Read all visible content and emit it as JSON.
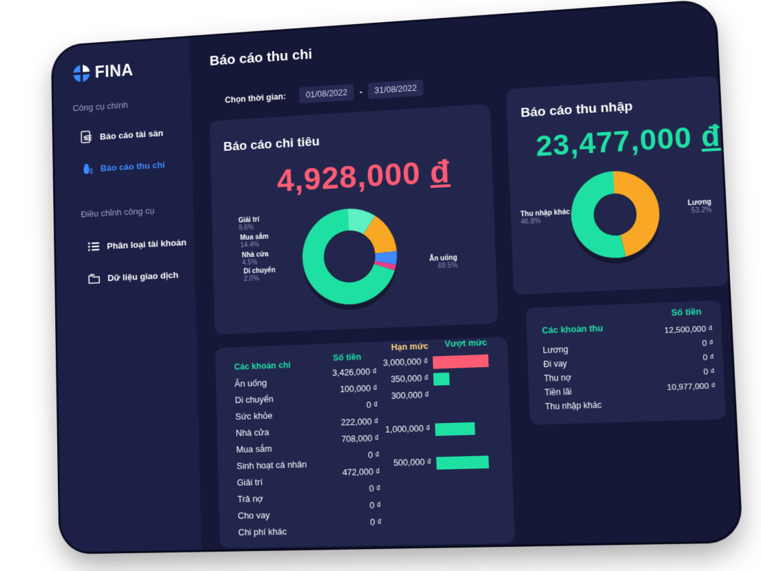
{
  "app": {
    "name": "FINA"
  },
  "sidebar": {
    "heading_main": "Công cụ chính",
    "items_main": [
      {
        "label": "Báo cáo tài sản"
      },
      {
        "label": "Báo cáo thu chi"
      }
    ],
    "heading_tools": "Điều chỉnh công cụ",
    "items_tools": [
      {
        "label": "Phân loại tài khoản"
      },
      {
        "label": "Dữ liệu giao dịch"
      }
    ]
  },
  "header": {
    "title": "Báo cáo thu chi",
    "date_label": "Chọn thời gian:",
    "date_from": "01/08/2022",
    "date_sep": "-",
    "date_to": "31/08/2022"
  },
  "expense": {
    "title": "Báo cáo chi tiêu",
    "total": "4,928,000",
    "currency": "đ",
    "color": "#ff5c74",
    "slices": [
      {
        "name": "Giải trí",
        "pct": "9.6%",
        "value": 9.6,
        "color": "#5eefc3"
      },
      {
        "name": "Mua sắm",
        "pct": "14.4%",
        "value": 14.4,
        "color": "#f9a825"
      },
      {
        "name": "Nhà cửa",
        "pct": "4.5%",
        "value": 4.5,
        "color": "#3d8bff"
      },
      {
        "name": "Di chuyển",
        "pct": "2.0%",
        "value": 2.0,
        "color": "#e83e8c"
      },
      {
        "name": "Ăn uống",
        "pct": "69.5%",
        "value": 69.5,
        "color": "#1fe0a3"
      }
    ],
    "table": {
      "col_category": "Các khoản chi",
      "col_amount": "Số tiền",
      "col_limit": "Hạn mức",
      "col_over": "Vượt mức",
      "rows": [
        {
          "name": "Ăn uống",
          "amount": "3,426,000 ₫",
          "limit": "3,000,000 ₫",
          "bar": 1.0,
          "bar_color": "#ff5c74"
        },
        {
          "name": "Di chuyển",
          "amount": "100,000 ₫",
          "limit": "350,000 ₫",
          "bar": 0.29,
          "bar_color": "#1fe0a3"
        },
        {
          "name": "Sức khỏe",
          "amount": "0 ₫",
          "limit": "300,000 ₫",
          "bar": 0,
          "bar_color": "#1fe0a3"
        },
        {
          "name": "Nhà cửa",
          "amount": "222,000 ₫",
          "limit": "",
          "bar": 0,
          "bar_color": "#1fe0a3"
        },
        {
          "name": "Mua sắm",
          "amount": "708,000 ₫",
          "limit": "1,000,000 ₫",
          "bar": 0.71,
          "bar_color": "#1fe0a3"
        },
        {
          "name": "Sinh hoạt cá nhân",
          "amount": "0 ₫",
          "limit": "",
          "bar": 0,
          "bar_color": "#1fe0a3"
        },
        {
          "name": "Giải trí",
          "amount": "472,000 ₫",
          "limit": "500,000 ₫",
          "bar": 0.94,
          "bar_color": "#1fe0a3"
        },
        {
          "name": "Trả nợ",
          "amount": "0 ₫",
          "limit": "",
          "bar": 0,
          "bar_color": "#1fe0a3"
        },
        {
          "name": "Cho vay",
          "amount": "0 ₫",
          "limit": "",
          "bar": 0,
          "bar_color": "#1fe0a3"
        },
        {
          "name": "Chi phí khác",
          "amount": "0 ₫",
          "limit": "",
          "bar": 0,
          "bar_color": "#1fe0a3"
        }
      ]
    }
  },
  "income": {
    "title": "Báo cáo thu nhập",
    "total": "23,477,000",
    "currency": "đ",
    "color": "#1fe0a3",
    "slices": [
      {
        "name": "Thu nhập khác",
        "pct": "46.8%",
        "value": 46.8,
        "color": "#f9a825"
      },
      {
        "name": "Lương",
        "pct": "53.2%",
        "value": 53.2,
        "color": "#1fe0a3"
      }
    ],
    "table": {
      "col_category": "Các khoản thu",
      "col_amount": "Số tiền",
      "rows": [
        {
          "name": "Lương",
          "amount": "12,500,000 ₫"
        },
        {
          "name": "Đi vay",
          "amount": "0 ₫"
        },
        {
          "name": "Thu nợ",
          "amount": "0 ₫"
        },
        {
          "name": "Tiền lãi",
          "amount": "0 ₫"
        },
        {
          "name": "Thu nhập khác",
          "amount": "10,977,000 ₫"
        }
      ]
    }
  },
  "colors": {
    "accent_blue": "#3d8bff",
    "bg": "#151837",
    "card": "#22264d",
    "limit_header": "#ffd37a",
    "over_header": "#1fe0a3"
  }
}
